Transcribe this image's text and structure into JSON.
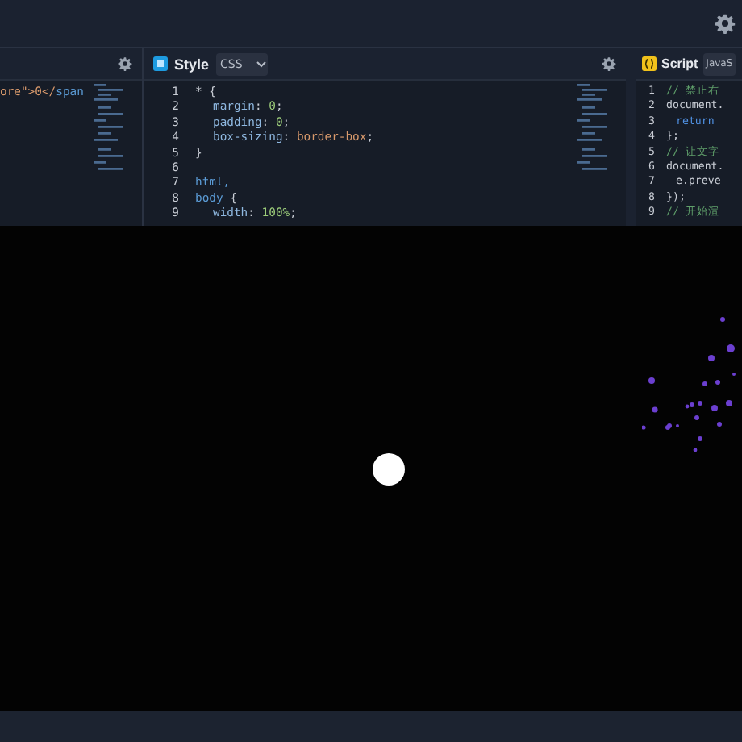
{
  "html_panel": {
    "code_lines": [
      [
        {
          "t": "ore\">0</",
          "color": "#d99a6c"
        },
        {
          "t": "span",
          "color": "#5b9bd5"
        }
      ]
    ]
  },
  "style_panel": {
    "title": "Style",
    "language": "CSS",
    "lines": [
      {
        "number": "1",
        "tokens": [
          {
            "t": "* {",
            "color": "#c8ccd4"
          }
        ],
        "indent": false
      },
      {
        "number": "2",
        "tokens": [
          {
            "t": "margin",
            "color": "#8fb8e0"
          },
          {
            "t": ": ",
            "color": "#c8ccd4"
          },
          {
            "t": "0",
            "color": "#9ccc7a"
          },
          {
            "t": ";",
            "color": "#c8ccd4"
          }
        ],
        "indent": true
      },
      {
        "number": "3",
        "tokens": [
          {
            "t": "padding",
            "color": "#8fb8e0"
          },
          {
            "t": ": ",
            "color": "#c8ccd4"
          },
          {
            "t": "0",
            "color": "#9ccc7a"
          },
          {
            "t": ";",
            "color": "#c8ccd4"
          }
        ],
        "indent": true
      },
      {
        "number": "4",
        "tokens": [
          {
            "t": "box-sizing",
            "color": "#8fb8e0"
          },
          {
            "t": ": ",
            "color": "#c8ccd4"
          },
          {
            "t": "border-box",
            "color": "#d99a6c"
          },
          {
            "t": ";",
            "color": "#c8ccd4"
          }
        ],
        "indent": true
      },
      {
        "number": "5",
        "tokens": [
          {
            "t": "}",
            "color": "#c8ccd4"
          }
        ],
        "indent": false
      },
      {
        "number": "6"
      },
      {
        "number": "7",
        "tokens": [
          {
            "t": "html,",
            "color": "#5b9bd5"
          }
        ],
        "indent": false
      },
      {
        "number": "8",
        "tokens": [
          {
            "t": "body ",
            "color": "#5b9bd5"
          },
          {
            "t": "{",
            "color": "#c8ccd4"
          }
        ],
        "indent": false
      },
      {
        "number": "9",
        "tokens": [
          {
            "t": "width",
            "color": "#8fb8e0"
          },
          {
            "t": ": ",
            "color": "#c8ccd4"
          },
          {
            "t": "100%",
            "color": "#9ccc7a"
          },
          {
            "t": ";",
            "color": "#c8ccd4"
          }
        ],
        "indent": true
      }
    ]
  },
  "script_panel": {
    "title": "Script",
    "language": "JavaS",
    "lines": [
      {
        "number": "1",
        "tokens": [
          {
            "t": "// 禁止右",
            "color": "#5f9f6a"
          }
        ],
        "indent": false
      },
      {
        "number": "2",
        "tokens": [
          {
            "t": "document.",
            "color": "#c8ccd4"
          }
        ],
        "indent": false
      },
      {
        "number": "3",
        "tokens": [
          {
            "t": "return",
            "color": "#4f8fe0"
          }
        ],
        "indent": true
      },
      {
        "number": "4",
        "tokens": [
          {
            "t": "};",
            "color": "#c8ccd4"
          }
        ],
        "indent": false
      },
      {
        "number": "5",
        "tokens": [
          {
            "t": "// 让文字",
            "color": "#5f9f6a"
          }
        ],
        "indent": false
      },
      {
        "number": "6",
        "tokens": [
          {
            "t": "document.",
            "color": "#c8ccd4"
          }
        ],
        "indent": false
      },
      {
        "number": "7",
        "tokens": [
          {
            "t": "e.preve",
            "color": "#c8ccd4"
          }
        ],
        "indent": true
      },
      {
        "number": "8",
        "tokens": [
          {
            "t": "});",
            "color": "#c8ccd4"
          }
        ],
        "indent": false
      },
      {
        "number": "9",
        "tokens": [
          {
            "t": "// 开始渲",
            "color": "#5f9f6a"
          }
        ],
        "indent": false
      }
    ]
  }
}
